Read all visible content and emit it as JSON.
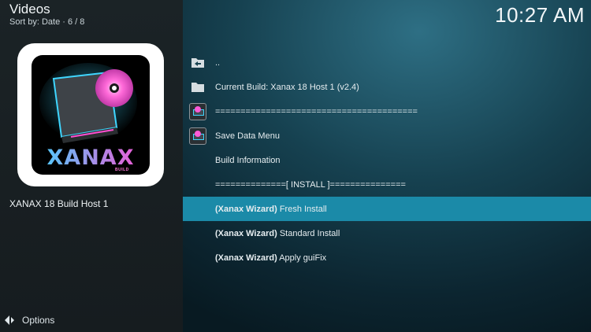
{
  "header": {
    "title": "Videos",
    "subtitle": "Sort by: Date · 6 / 8",
    "clock": "10:27 AM"
  },
  "preview": {
    "logo_text": "XANAX",
    "logo_sub": "BUILD",
    "item_name": "XANAX 18 Build Host 1"
  },
  "footer": {
    "options_label": "Options"
  },
  "list": {
    "items": [
      {
        "icon": "folder-back-icon",
        "prefix": "",
        "label": ".."
      },
      {
        "icon": "folder-icon",
        "prefix": "",
        "label": "Current Build: Xanax 18 Host 1 (v2.4)"
      },
      {
        "icon": "xanax-logo-icon",
        "prefix": "",
        "label": "========================================"
      },
      {
        "icon": "xanax-logo-icon",
        "prefix": "",
        "label": "Save Data Menu"
      },
      {
        "icon": "",
        "prefix": "",
        "label": "Build Information"
      },
      {
        "icon": "",
        "prefix": "",
        "label": "==============[ INSTALL ]==============="
      },
      {
        "icon": "",
        "prefix": "(Xanax Wizard)",
        "label": "Fresh Install",
        "selected": true
      },
      {
        "icon": "",
        "prefix": "(Xanax Wizard)",
        "label": "Standard Install"
      },
      {
        "icon": "",
        "prefix": "(Xanax Wizard)",
        "label": "Apply guiFix"
      }
    ]
  },
  "colors": {
    "selection": "#1b8aa8",
    "logo_cyan": "#3fd6ff",
    "logo_pink": "#ff4fd2"
  }
}
